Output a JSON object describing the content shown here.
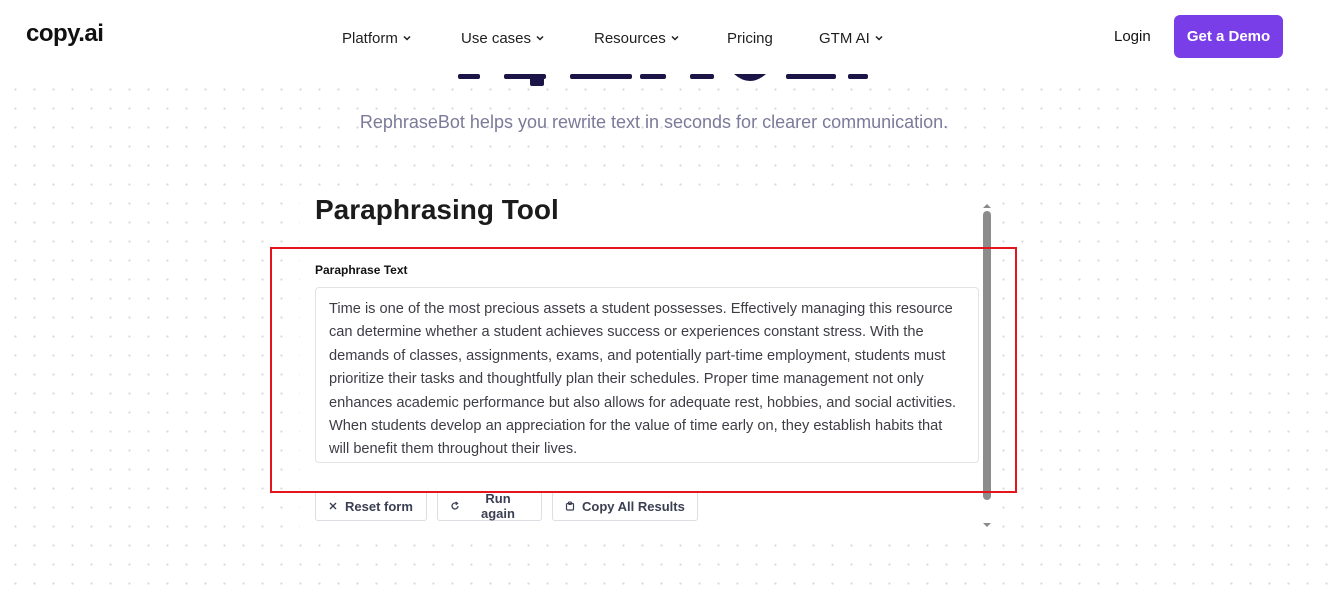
{
  "header": {
    "logo": "copy.ai",
    "nav": [
      {
        "label": "Platform",
        "has_dropdown": true
      },
      {
        "label": "Use cases",
        "has_dropdown": true
      },
      {
        "label": "Resources",
        "has_dropdown": true
      },
      {
        "label": "Pricing",
        "has_dropdown": false
      },
      {
        "label": "GTM AI",
        "has_dropdown": true
      }
    ],
    "login": "Login",
    "cta": "Get a Demo"
  },
  "hero": {
    "subtitle": "RephraseBot helps you rewrite text in seconds for clearer communication."
  },
  "tool": {
    "title": "Paraphrasing Tool",
    "field_label": "Paraphrase Text",
    "text": "Time is one of the most precious assets a student possesses. Effectively managing this resource can determine whether a student achieves success or experiences constant stress. With the demands of classes, assignments, exams, and potentially part-time employment, students must prioritize their tasks and thoughtfully plan their schedules. Proper time management not only enhances academic performance but also allows for adequate rest, hobbies, and social activities. When students develop an appreciation for the value of time early on, they establish habits that will benefit them throughout their lives.",
    "buttons": {
      "reset": "Reset form",
      "run": "Run again",
      "copy": "Copy All Results"
    }
  },
  "icons": {
    "nav_dropdown": "chevron-down-icon",
    "reset": "close-icon",
    "run": "refresh-icon",
    "copy": "clipboard-icon"
  },
  "colors": {
    "accent": "#7a3ee8",
    "highlight": "#e3161b",
    "heading": "#1b1446",
    "subtitle": "#7b7a9a"
  }
}
